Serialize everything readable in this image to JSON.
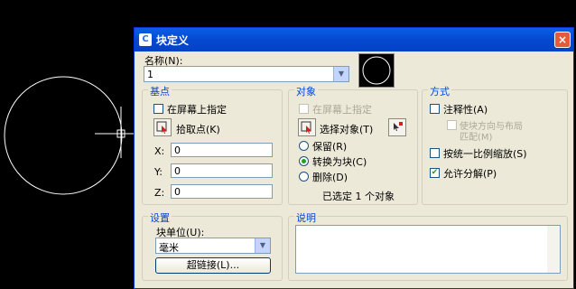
{
  "dialog": {
    "title": "块定义",
    "close_glyph": "×",
    "name_label": "名称(N):",
    "name_value": "1",
    "base_point": {
      "group_label": "基点",
      "specify_on_screen": "在屏幕上指定",
      "pick_point": "拾取点(K)",
      "x_label": "X:",
      "x_value": "0",
      "y_label": "Y:",
      "y_value": "0",
      "z_label": "Z:",
      "z_value": "0"
    },
    "objects": {
      "group_label": "对象",
      "specify_on_screen": "在屏幕上指定",
      "select_objects": "选择对象(T)",
      "retain": "保留(R)",
      "convert_to_block": "转换为块(C)",
      "delete": "删除(D)",
      "selected_count": "已选定 1 个对象"
    },
    "behavior": {
      "group_label": "方式",
      "annotative": "注释性(A)",
      "match_orientation_line1": "使块方向与布局",
      "match_orientation_line2": "匹配(M)",
      "scale_uniformly": "按统一比例缩放(S)",
      "allow_exploding": "允许分解(P)"
    },
    "settings": {
      "group_label": "设置",
      "block_unit_label": "块单位(U):",
      "block_unit_value": "毫米",
      "hyperlink": "超链接(L)..."
    },
    "description": {
      "group_label": "说明",
      "text": ""
    }
  },
  "colors": {
    "titlebar": "#0a5fe6",
    "dialog_bg": "#ece9d8",
    "group_label": "#0046d5"
  }
}
